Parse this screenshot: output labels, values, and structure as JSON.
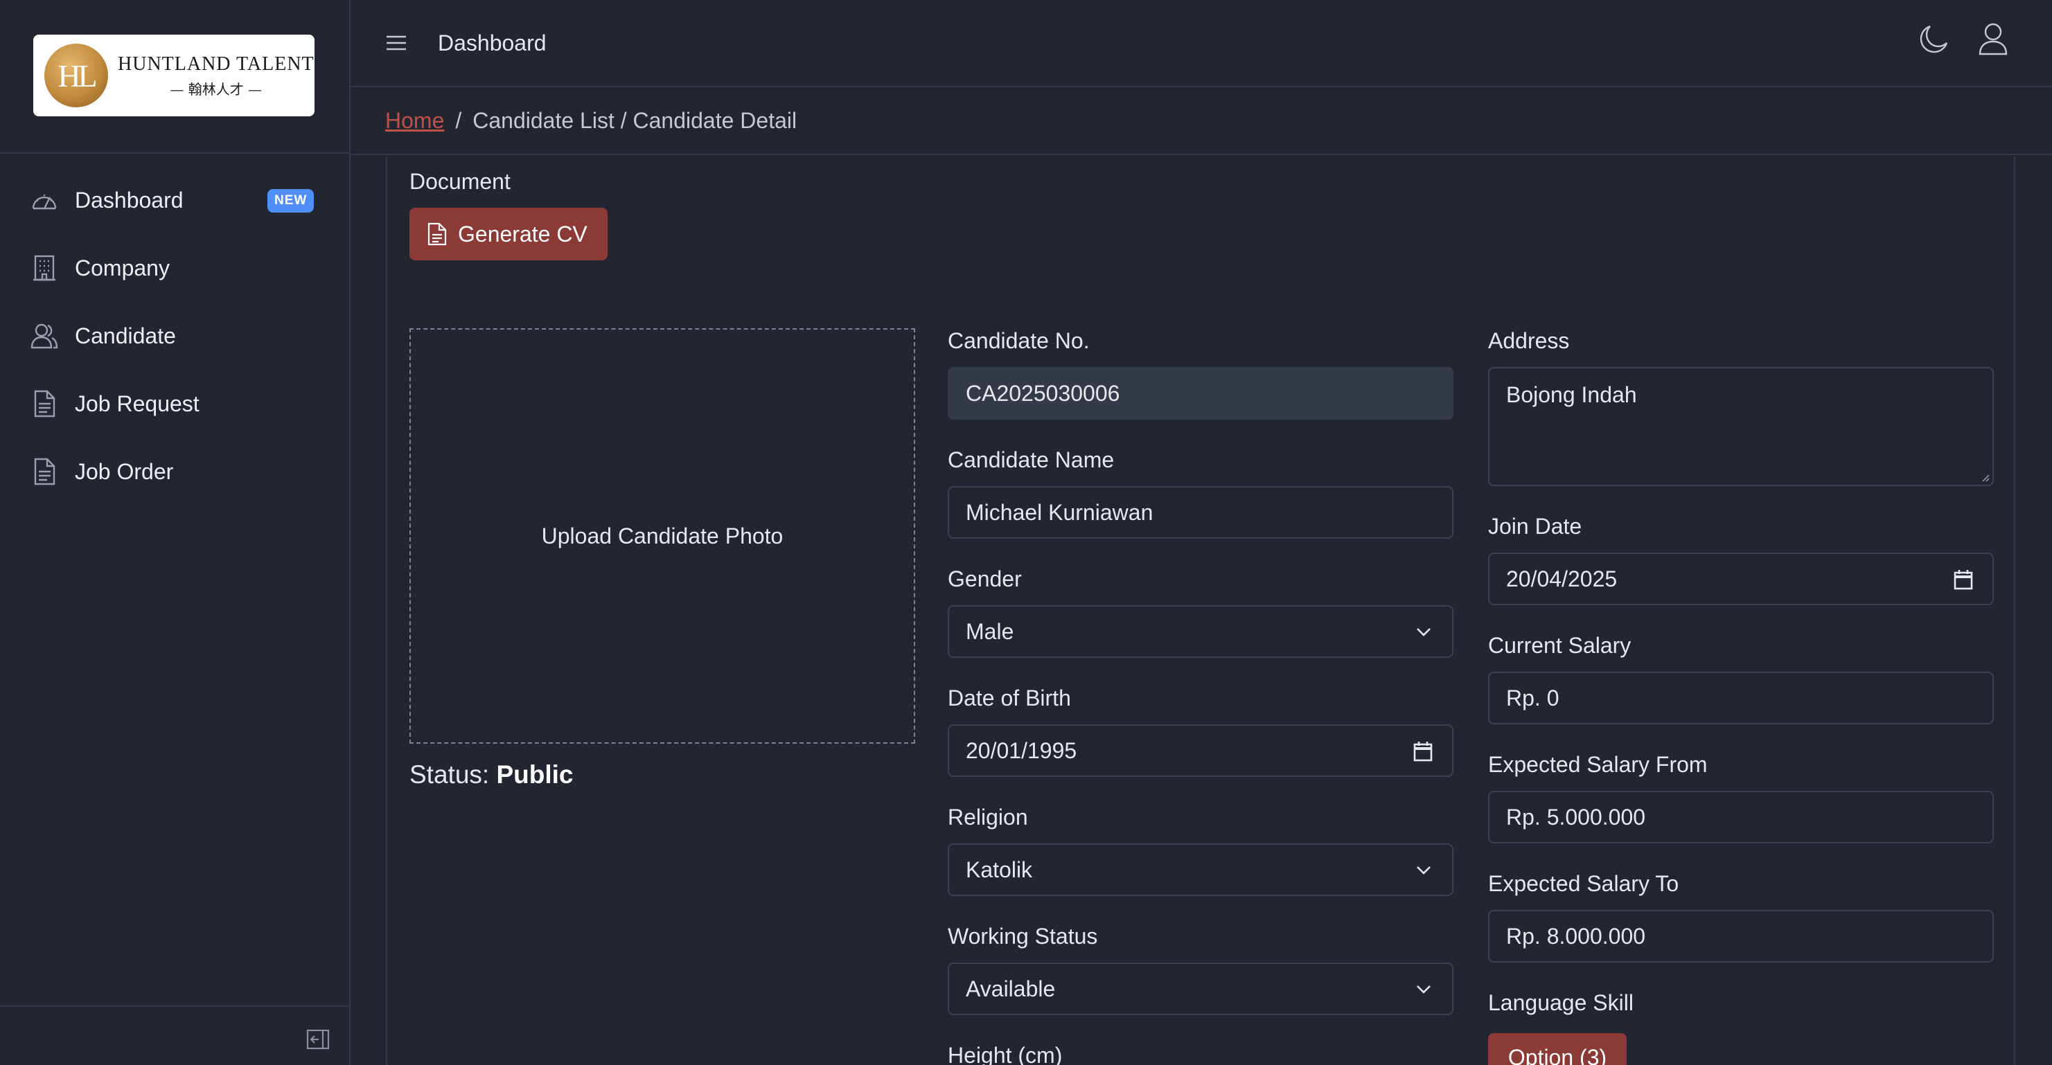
{
  "brand": {
    "logo_initials": "HL",
    "logo_name": "HUNTLAND TALENT",
    "logo_subtitle": "— 翰林人才 —"
  },
  "sidebar": {
    "items": [
      {
        "label": "Dashboard",
        "icon": "speedometer-icon",
        "badge": "NEW"
      },
      {
        "label": "Company",
        "icon": "building-icon"
      },
      {
        "label": "Candidate",
        "icon": "people-icon"
      },
      {
        "label": "Job Request",
        "icon": "document-icon"
      },
      {
        "label": "Job Order",
        "icon": "document-icon"
      }
    ]
  },
  "header": {
    "title": "Dashboard"
  },
  "breadcrumb": {
    "home": "Home",
    "sep": "/",
    "rest": "Candidate List / Candidate Detail"
  },
  "document": {
    "label": "Document",
    "generate_label": "Generate CV"
  },
  "photo": {
    "upload_label": "Upload Candidate Photo"
  },
  "status": {
    "label": "Status:",
    "value": "Public"
  },
  "form": {
    "candidate_no": {
      "label": "Candidate No.",
      "value": "CA2025030006"
    },
    "candidate_name": {
      "label": "Candidate Name",
      "value": "Michael Kurniawan"
    },
    "gender": {
      "label": "Gender",
      "value": "Male"
    },
    "dob": {
      "label": "Date of Birth",
      "value": "20/01/1995"
    },
    "religion": {
      "label": "Religion",
      "value": "Katolik"
    },
    "working_status": {
      "label": "Working Status",
      "value": "Available"
    },
    "height": {
      "label": "Height (cm)"
    },
    "address": {
      "label": "Address",
      "value": "Bojong Indah"
    },
    "join_date": {
      "label": "Join Date",
      "value": "20/04/2025"
    },
    "current_salary": {
      "label": "Current Salary",
      "value": "Rp. 0"
    },
    "expected_from": {
      "label": "Expected Salary From",
      "value": "Rp. 5.000.000"
    },
    "expected_to": {
      "label": "Expected Salary To",
      "value": "Rp. 8.000.000"
    },
    "language_skill": {
      "label": "Language Skill",
      "button": "Option (3)"
    }
  },
  "colors": {
    "background": "#212631",
    "accent_red": "#8c3a36",
    "badge_blue": "#4f8ff7",
    "link_red": "#c0504a"
  }
}
